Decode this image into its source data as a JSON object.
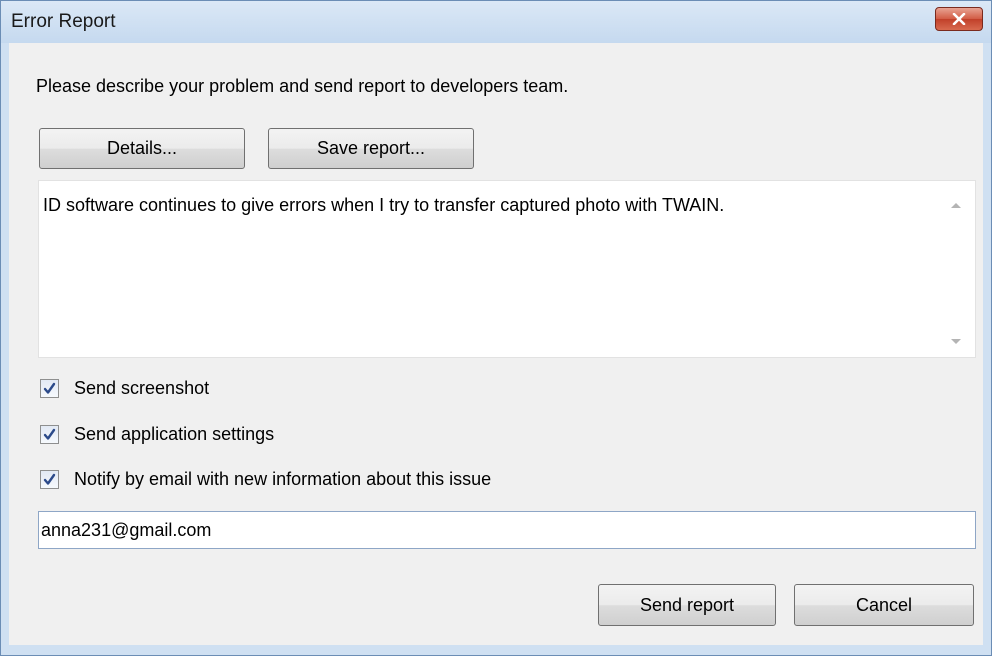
{
  "window": {
    "title": "Error Report",
    "close_label": "Close"
  },
  "dialog": {
    "description": "Please describe your problem and send report to developers team.",
    "details_label": "Details...",
    "save_report_label": "Save report...",
    "problem_text": "ID software continues to give errors when I try to transfer captured photo with TWAIN.",
    "checkboxes": [
      {
        "label": "Send screenshot",
        "checked": true
      },
      {
        "label": "Send application settings",
        "checked": true
      },
      {
        "label": "Notify by email with new information about this issue",
        "checked": true
      }
    ],
    "email_value": "anna231@gmail.com",
    "send_report_label": "Send report",
    "cancel_label": "Cancel"
  },
  "icons": {
    "close": "close-icon",
    "checkmark": "checkmark-icon",
    "scroll_up": "scroll-up-arrow-icon",
    "scroll_down": "scroll-down-arrow-icon"
  },
  "colors": {
    "title_bar": "#c5d9ef",
    "close_button": "#c1402a",
    "dialog_background": "#f0f0f0",
    "checkmark": "#2b4a8a"
  }
}
